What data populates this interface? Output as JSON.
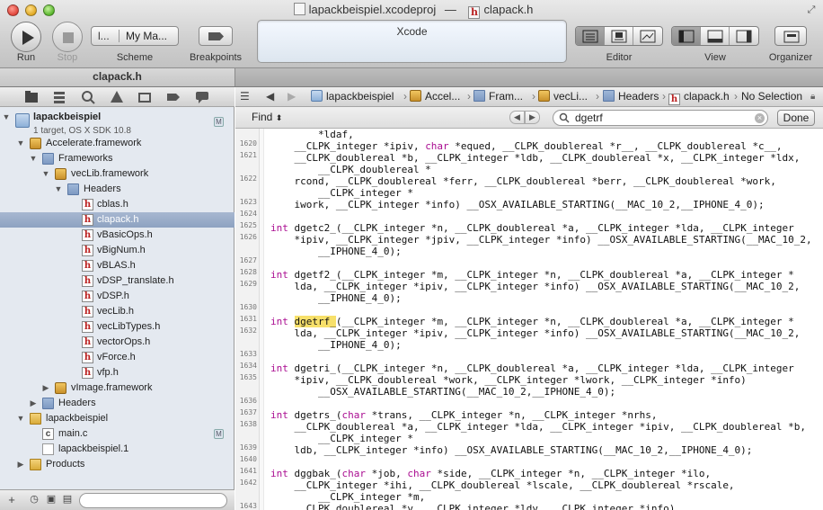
{
  "window": {
    "project_file": "lapackbeispiel.xcodeproj",
    "separator": "—",
    "open_file": "clapack.h"
  },
  "toolbar": {
    "run_label": "Run",
    "stop_label": "Stop",
    "scheme_label": "Scheme",
    "scheme_target": "l...",
    "scheme_destination": "My Ma...",
    "breakpoints_label": "Breakpoints",
    "activity_title": "Xcode",
    "editor_label": "Editor",
    "view_label": "View",
    "organizer_label": "Organizer"
  },
  "tab": {
    "label": "clapack.h"
  },
  "navigator": {
    "project": {
      "name": "lapackbeispiel",
      "subtitle": "1 target, OS X SDK 10.8",
      "badge": "M"
    },
    "items": [
      {
        "label": "Accelerate.framework"
      },
      {
        "label": "Frameworks"
      },
      {
        "label": "vecLib.framework"
      },
      {
        "label": "Headers"
      },
      {
        "label": "cblas.h"
      },
      {
        "label": "clapack.h"
      },
      {
        "label": "vBasicOps.h"
      },
      {
        "label": "vBigNum.h"
      },
      {
        "label": "vBLAS.h"
      },
      {
        "label": "vDSP_translate.h"
      },
      {
        "label": "vDSP.h"
      },
      {
        "label": "vecLib.h"
      },
      {
        "label": "vecLibTypes.h"
      },
      {
        "label": "vectorOps.h"
      },
      {
        "label": "vForce.h"
      },
      {
        "label": "vfp.h"
      },
      {
        "label": "vImage.framework"
      },
      {
        "label": "Headers"
      },
      {
        "label": "lapackbeispiel"
      },
      {
        "label": "main.c",
        "badge": "M"
      },
      {
        "label": "lapackbeispiel.1"
      },
      {
        "label": "Products"
      }
    ]
  },
  "jumpbar": {
    "crumbs": [
      "lapackbeispiel",
      "Accel...",
      "Fram...",
      "vecLi...",
      "Headers",
      "clapack.h",
      "No Selection"
    ]
  },
  "find": {
    "mode": "Find",
    "query": "dgetrf",
    "done_label": "Done"
  },
  "editor": {
    "line_numbers": [
      "1620",
      "1621",
      "",
      "1622",
      "",
      "1623",
      "1624",
      "1625",
      "1626",
      "",
      "1627",
      "1628",
      "1629",
      "",
      "1630",
      "1631",
      "1632",
      "",
      "1633",
      "1634",
      "1635",
      "",
      "1636",
      "1637",
      "1638",
      "",
      "1639",
      "1640",
      "1641",
      "1642",
      "",
      "1643"
    ],
    "code": {
      "l0": "        *ldaf,",
      "l1a": "    __CLPK_integer *ipiv, ",
      "l1b": "char",
      "l1c": " *equed, __CLPK_doublereal *r__, __CLPK_doublereal *c__,",
      "l2": "    __CLPK_doublereal *b, __CLPK_integer *ldb, __CLPK_doublereal *x, __CLPK_integer *ldx,",
      "l3": "        __CLPK_doublereal *",
      "l4": "    rcond, __CLPK_doublereal *ferr, __CLPK_doublereal *berr, __CLPK_doublereal *work,",
      "l5": "        __CLPK_integer *",
      "l6": "    iwork, __CLPK_integer *info) __OSX_AVAILABLE_STARTING(__MAC_10_2,__IPHONE_4_0);",
      "kw_int": "int",
      "l8": " dgetc2_(__CLPK_integer *n, __CLPK_doublereal *a, __CLPK_integer *lda, __CLPK_integer",
      "l9": "    *ipiv, __CLPK_integer *jpiv, __CLPK_integer *info) __OSX_AVAILABLE_STARTING(__MAC_10_2,",
      "l10": "        __IPHONE_4_0);",
      "l12": " dgetf2_(__CLPK_integer *m, __CLPK_integer *n, __CLPK_doublereal *a, __CLPK_integer *",
      "l13": "    lda, __CLPK_integer *ipiv, __CLPK_integer *info) __OSX_AVAILABLE_STARTING(__MAC_10_2,",
      "l14": "        __IPHONE_4_0);",
      "l16a": "dgetrf_",
      "l16b": "(__CLPK_integer *m, __CLPK_integer *n, __CLPK_doublereal *a, __CLPK_integer *",
      "l17": "    lda, __CLPK_integer *ipiv, __CLPK_integer *info) __OSX_AVAILABLE_STARTING(__MAC_10_2,",
      "l18": "        __IPHONE_4_0);",
      "l20": " dgetri_(__CLPK_integer *n, __CLPK_doublereal *a, __CLPK_integer *lda, __CLPK_integer",
      "l21": "    *ipiv, __CLPK_doublereal *work, __CLPK_integer *lwork, __CLPK_integer *info)",
      "l22": "        __OSX_AVAILABLE_STARTING(__MAC_10_2,__IPHONE_4_0);",
      "l24a": " dgetrs_(",
      "l24b": "char",
      "l24c": " *trans, __CLPK_integer *n, __CLPK_integer *nrhs,",
      "l25": "    __CLPK_doublereal *a, __CLPK_integer *lda, __CLPK_integer *ipiv, __CLPK_doublereal *b,",
      "l26": "        __CLPK_integer *",
      "l27": "    ldb, __CLPK_integer *info) __OSX_AVAILABLE_STARTING(__MAC_10_2,__IPHONE_4_0);",
      "l29a": " dggbak_(",
      "l29b": "char",
      "l29c": " *job, ",
      "l29d": "char",
      "l29e": " *side, __CLPK_integer *n, __CLPK_integer *ilo,",
      "l30": "    __CLPK_integer *ihi, __CLPK_doublereal *lscale, __CLPK_doublereal *rscale,",
      "l31": "        __CLPK_integer *m,",
      "l32": "    __CLPK_doublereal *v, __CLPK_integer *ldv, __CLPK_integer *info)"
    }
  }
}
